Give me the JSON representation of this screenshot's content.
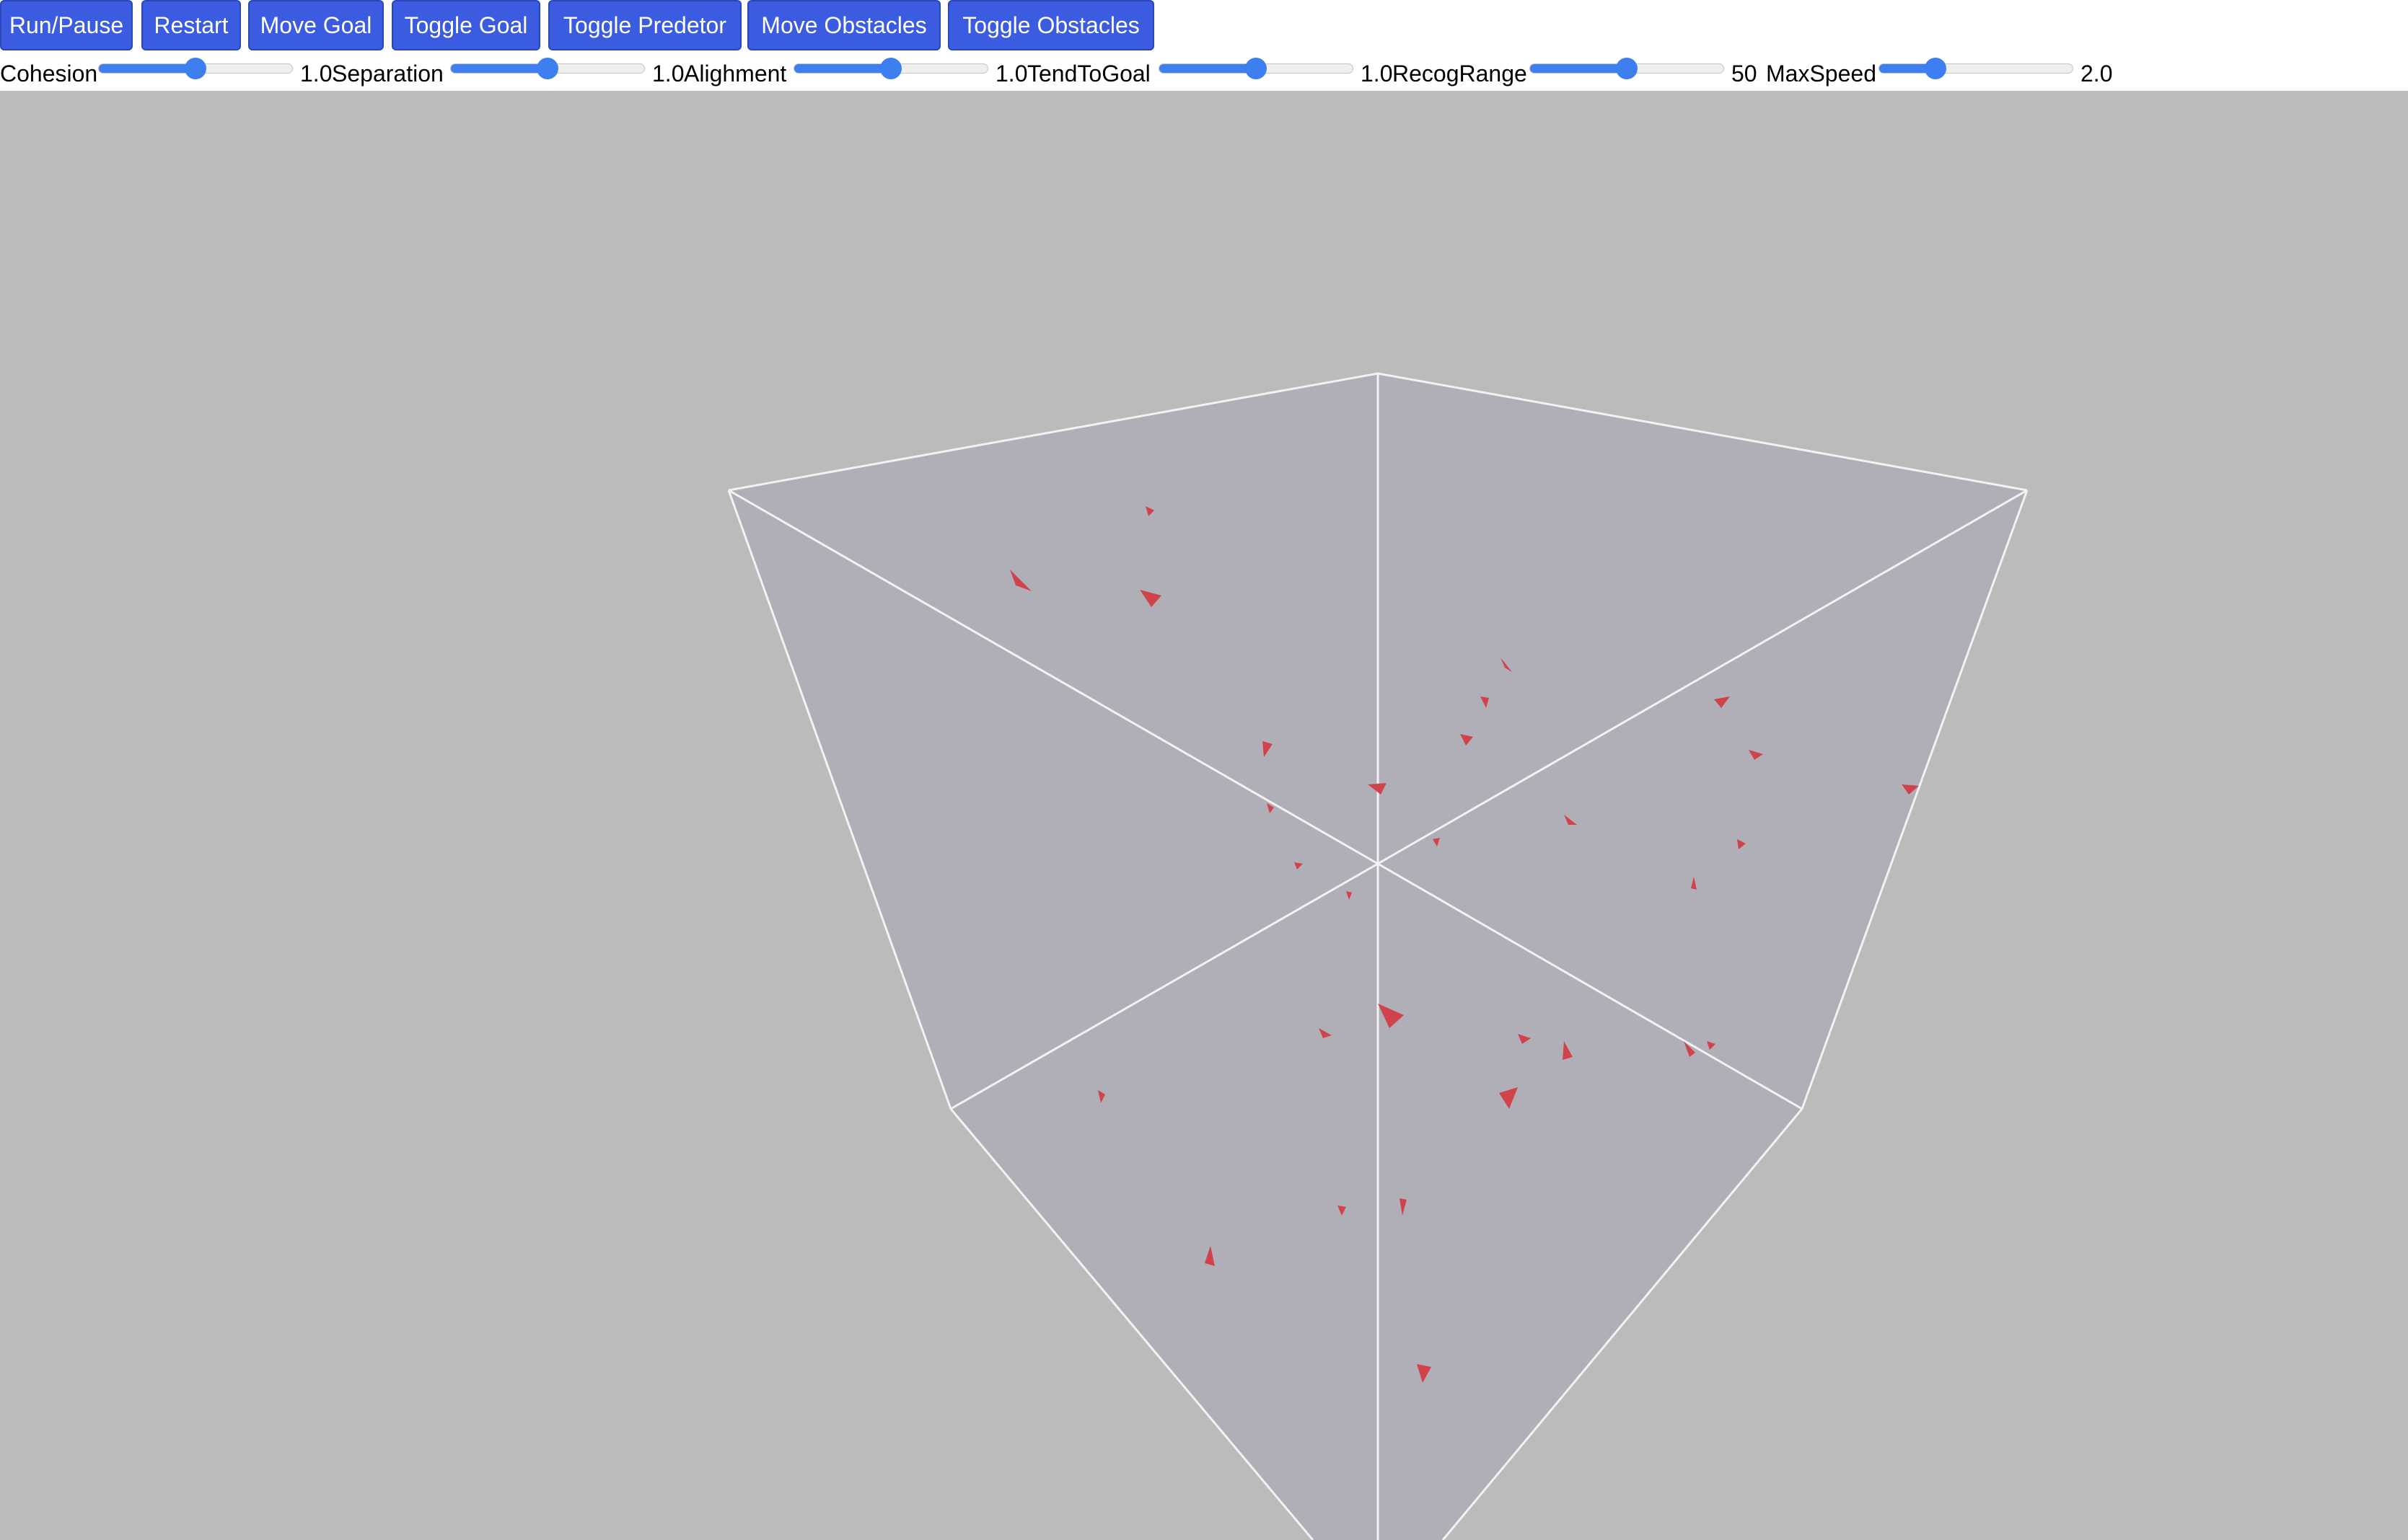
{
  "toolbar": {
    "buttons": [
      {
        "id": "run-pause",
        "label": "Run/Pause"
      },
      {
        "id": "restart",
        "label": "Restart"
      },
      {
        "id": "move-goal",
        "label": "Move Goal"
      },
      {
        "id": "toggle-goal",
        "label": "Toggle Goal"
      },
      {
        "id": "toggle-predetor",
        "label": "Toggle Predetor"
      },
      {
        "id": "move-obstacles",
        "label": "Move Obstacles"
      },
      {
        "id": "toggle-obstacles",
        "label": "Toggle Obstacles"
      }
    ]
  },
  "sliders": [
    {
      "label": "Cohesion",
      "value": "1.0",
      "level": 0.5
    },
    {
      "label": "Separation",
      "value": "1.0",
      "level": 0.5
    },
    {
      "label": "Alighment",
      "value": "1.0",
      "level": 0.5
    },
    {
      "label": "TendToGoal",
      "value": "1.0",
      "level": 0.5
    },
    {
      "label": "RecogRange",
      "value": "50",
      "level": 0.5
    },
    {
      "label": "MaxSpeed",
      "value": "2.0",
      "level": 0.29
    }
  ],
  "colors": {
    "button_bg": "#3b5ce0",
    "slider_accent": "#3d7ff0",
    "viewport_bg": "#bbbbbb",
    "cube_face": "#b0afb8",
    "cube_edge": "#ffffff",
    "boid": "#d0434b"
  }
}
